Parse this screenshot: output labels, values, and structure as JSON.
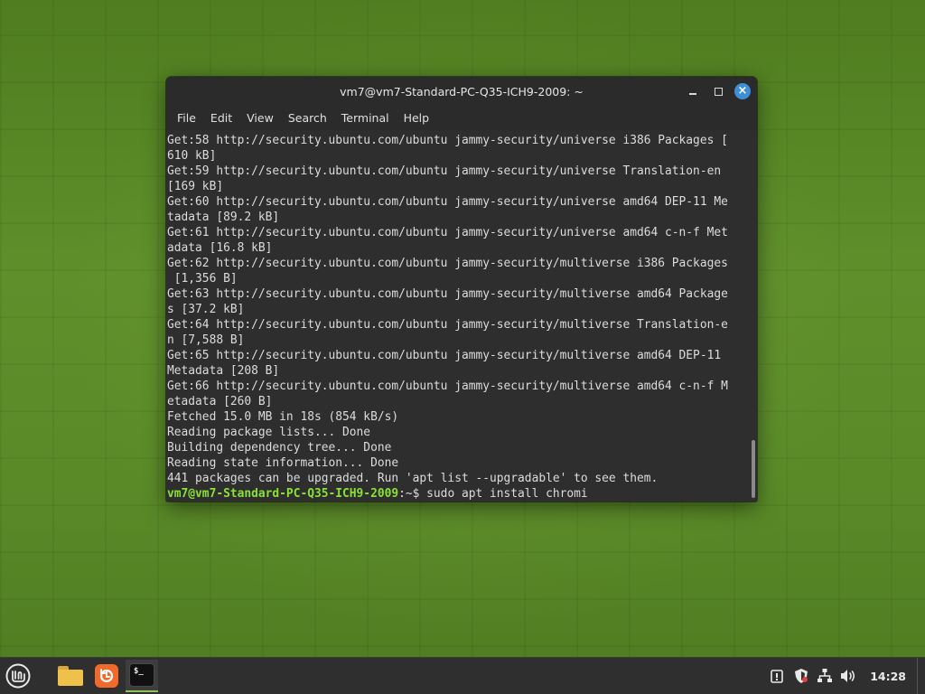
{
  "window": {
    "title": "vm7@vm7-Standard-PC-Q35-ICH9-2009: ~",
    "controls": {
      "minimize_icon": "minimize-icon",
      "maximize_icon": "maximize-icon",
      "close_icon": "close-icon",
      "close_color": "#3f8fd6"
    }
  },
  "menubar": {
    "items": [
      "File",
      "Edit",
      "View",
      "Search",
      "Terminal",
      "Help"
    ]
  },
  "terminal": {
    "lines": [
      "Get:58 http://security.ubuntu.com/ubuntu jammy-security/universe i386 Packages [",
      "610 kB]",
      "Get:59 http://security.ubuntu.com/ubuntu jammy-security/universe Translation-en",
      "[169 kB]",
      "Get:60 http://security.ubuntu.com/ubuntu jammy-security/universe amd64 DEP-11 Me",
      "tadata [89.2 kB]",
      "Get:61 http://security.ubuntu.com/ubuntu jammy-security/universe amd64 c-n-f Met",
      "adata [16.8 kB]",
      "Get:62 http://security.ubuntu.com/ubuntu jammy-security/multiverse i386 Packages",
      " [1,356 B]",
      "Get:63 http://security.ubuntu.com/ubuntu jammy-security/multiverse amd64 Package",
      "s [37.2 kB]",
      "Get:64 http://security.ubuntu.com/ubuntu jammy-security/multiverse Translation-e",
      "n [7,588 B]",
      "Get:65 http://security.ubuntu.com/ubuntu jammy-security/multiverse amd64 DEP-11",
      "Metadata [208 B]",
      "Get:66 http://security.ubuntu.com/ubuntu jammy-security/multiverse amd64 c-n-f M",
      "etadata [260 B]",
      "Fetched 15.0 MB in 18s (854 kB/s)",
      "Reading package lists... Done",
      "Building dependency tree... Done",
      "Reading state information... Done",
      "441 packages can be upgraded. Run 'apt list --upgradable' to see them."
    ],
    "prompt_user": "vm7@vm7-Standard-PC-Q35-ICH9-2009",
    "prompt_suffix": ":~$ ",
    "command": "sudo apt install chromi",
    "prompt_color": "#8ae234"
  },
  "taskbar": {
    "menu_icon": "linux-mint-menu-icon",
    "launchers": [
      {
        "name": "files-launcher",
        "icon": "folder-icon"
      },
      {
        "name": "update-manager-launcher",
        "icon": "update-manager-icon"
      },
      {
        "name": "terminal-launcher",
        "icon": "terminal-icon",
        "label": "$_"
      }
    ],
    "tray": [
      "update-shield-icon",
      "network-icon",
      "volume-icon"
    ],
    "clock": "14:28",
    "accent": "#8fc257"
  }
}
